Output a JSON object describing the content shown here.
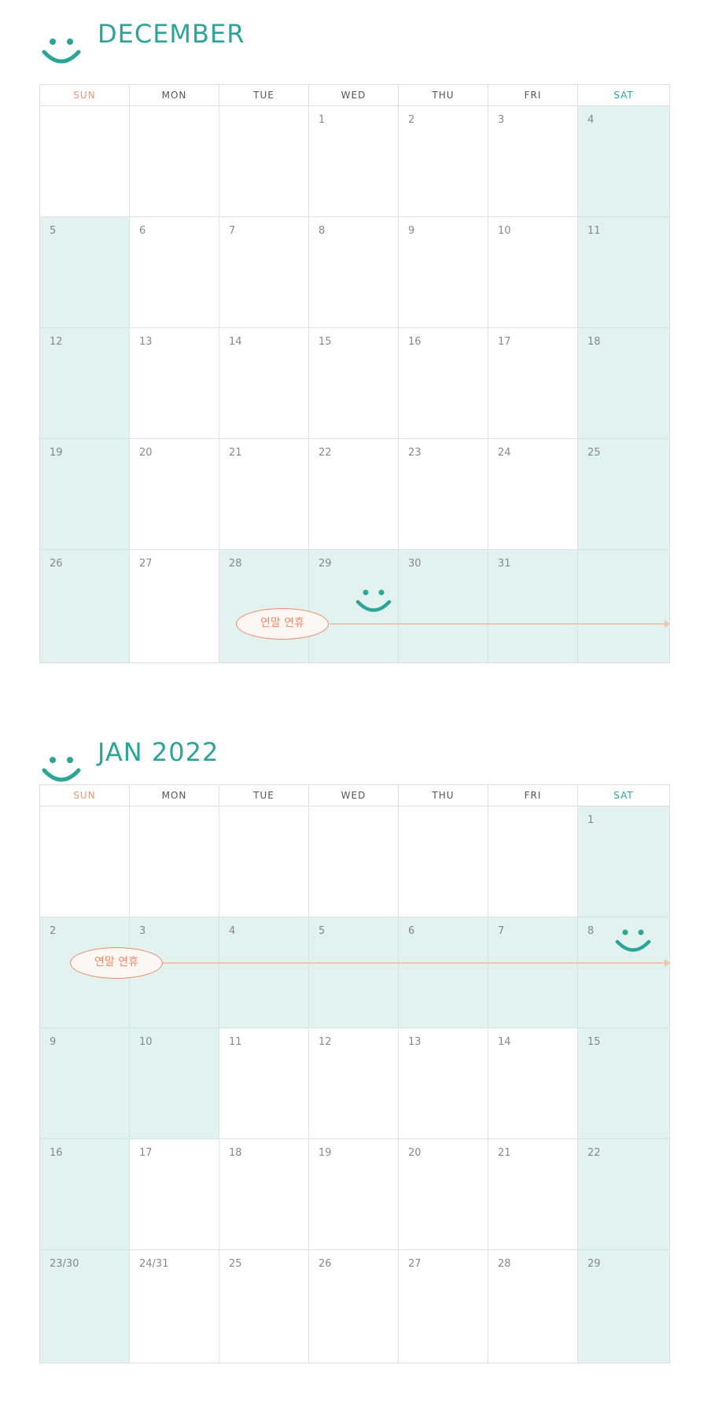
{
  "dow": [
    "SUN",
    "MON",
    "TUE",
    "WED",
    "THU",
    "FRI",
    "SAT"
  ],
  "colors": {
    "accent": "#2aa598",
    "sunday": "#f2956f",
    "highlight": "#e2f2ef",
    "event": "#f08a6a"
  },
  "months": [
    {
      "title": "DECEMBER",
      "days": [
        [
          "",
          "",
          "",
          "1",
          "2",
          "3",
          "4"
        ],
        [
          "5",
          "6",
          "7",
          "8",
          "9",
          "10",
          "11"
        ],
        [
          "12",
          "13",
          "14",
          "15",
          "16",
          "17",
          "18"
        ],
        [
          "19",
          "20",
          "21",
          "22",
          "23",
          "24",
          "25"
        ],
        [
          "26",
          "27",
          "28",
          "29",
          "30",
          "31",
          ""
        ]
      ],
      "event_label": "연말 연휴"
    },
    {
      "title": "JAN 2022",
      "days": [
        [
          "",
          "",
          "",
          "",
          "",
          "",
          "1"
        ],
        [
          "2",
          "3",
          "4",
          "5",
          "6",
          "7",
          "8"
        ],
        [
          "9",
          "10",
          "11",
          "12",
          "13",
          "14",
          "15"
        ],
        [
          "16",
          "17",
          "18",
          "19",
          "20",
          "21",
          "22"
        ],
        [
          "23/30",
          "24/31",
          "25",
          "26",
          "27",
          "28",
          "29"
        ]
      ],
      "event_label": "연말 연휴"
    }
  ],
  "icons": [
    "smiley-icon"
  ]
}
